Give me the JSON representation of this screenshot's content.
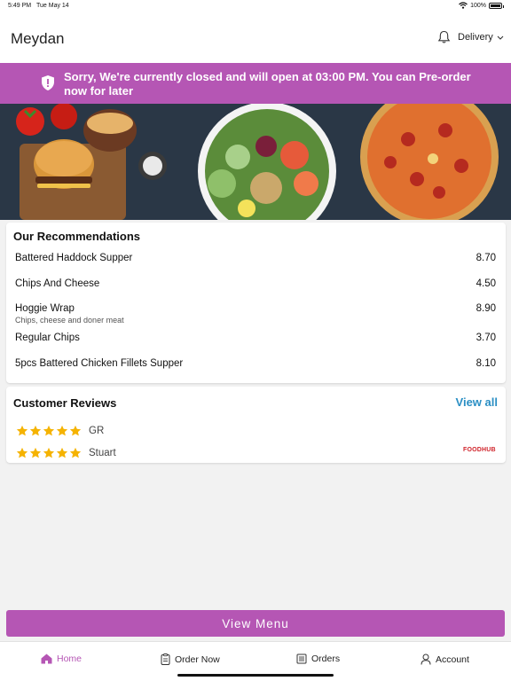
{
  "status_bar": {
    "time": "5:49 PM",
    "date": "Tue May 14",
    "battery": "100%",
    "wifi_icon": "wifi-icon",
    "battery_level": 1.0
  },
  "header": {
    "title": "Meydan",
    "bell_icon": "bell-icon",
    "order_type": "Delivery"
  },
  "banner": {
    "icon": "shield-alert-icon",
    "message": "Sorry, We're currently closed and will open at 03:00 PM. You can Pre-order now for later",
    "color": "#b556b4"
  },
  "recommendations": {
    "title": "Our Recommendations",
    "items": [
      {
        "name": "Battered Haddock Supper",
        "price": "8.70",
        "desc": ""
      },
      {
        "name": "Chips And Cheese",
        "price": "4.50",
        "desc": ""
      },
      {
        "name": "Hoggie Wrap",
        "price": "8.90",
        "desc": "Chips, cheese and doner meat"
      },
      {
        "name": "Regular Chips",
        "price": "3.70",
        "desc": ""
      },
      {
        "name": "5pcs Battered Chicken Fillets Supper",
        "price": "8.10",
        "desc": ""
      }
    ]
  },
  "reviews": {
    "title": "Customer Reviews",
    "view_all": "View all",
    "items": [
      {
        "name": "GR",
        "rating": 5
      },
      {
        "name": "Stuart",
        "rating": 5
      }
    ],
    "source": "FOODHUB",
    "link_color": "#2b8fc4",
    "star_color": "#f5b301"
  },
  "view_menu": "View Menu",
  "tabs": [
    {
      "label": "Home",
      "icon": "home-icon",
      "active": true
    },
    {
      "label": "Order Now",
      "icon": "order-now-icon",
      "active": false
    },
    {
      "label": "Orders",
      "icon": "orders-icon",
      "active": false
    },
    {
      "label": "Account",
      "icon": "account-icon",
      "active": false
    }
  ]
}
